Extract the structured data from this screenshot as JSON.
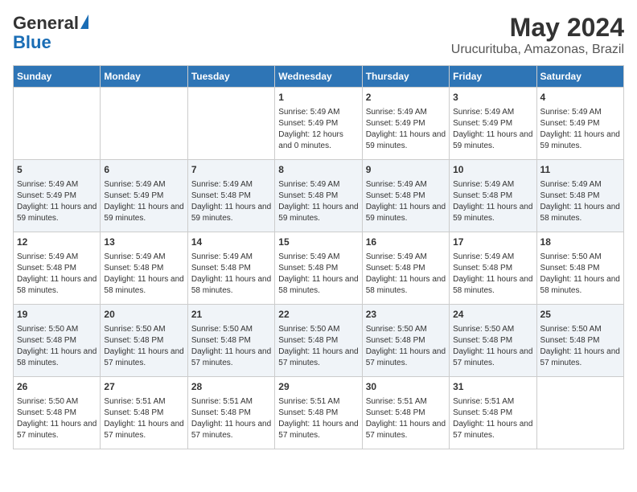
{
  "logo": {
    "general": "General",
    "blue": "Blue"
  },
  "title": "May 2024",
  "subtitle": "Urucurituba, Amazonas, Brazil",
  "days_of_week": [
    "Sunday",
    "Monday",
    "Tuesday",
    "Wednesday",
    "Thursday",
    "Friday",
    "Saturday"
  ],
  "weeks": [
    [
      {
        "day": "",
        "info": ""
      },
      {
        "day": "",
        "info": ""
      },
      {
        "day": "",
        "info": ""
      },
      {
        "day": "1",
        "info": "Sunrise: 5:49 AM\nSunset: 5:49 PM\nDaylight: 12 hours and 0 minutes."
      },
      {
        "day": "2",
        "info": "Sunrise: 5:49 AM\nSunset: 5:49 PM\nDaylight: 11 hours and 59 minutes."
      },
      {
        "day": "3",
        "info": "Sunrise: 5:49 AM\nSunset: 5:49 PM\nDaylight: 11 hours and 59 minutes."
      },
      {
        "day": "4",
        "info": "Sunrise: 5:49 AM\nSunset: 5:49 PM\nDaylight: 11 hours and 59 minutes."
      }
    ],
    [
      {
        "day": "5",
        "info": "Sunrise: 5:49 AM\nSunset: 5:49 PM\nDaylight: 11 hours and 59 minutes."
      },
      {
        "day": "6",
        "info": "Sunrise: 5:49 AM\nSunset: 5:49 PM\nDaylight: 11 hours and 59 minutes."
      },
      {
        "day": "7",
        "info": "Sunrise: 5:49 AM\nSunset: 5:48 PM\nDaylight: 11 hours and 59 minutes."
      },
      {
        "day": "8",
        "info": "Sunrise: 5:49 AM\nSunset: 5:48 PM\nDaylight: 11 hours and 59 minutes."
      },
      {
        "day": "9",
        "info": "Sunrise: 5:49 AM\nSunset: 5:48 PM\nDaylight: 11 hours and 59 minutes."
      },
      {
        "day": "10",
        "info": "Sunrise: 5:49 AM\nSunset: 5:48 PM\nDaylight: 11 hours and 59 minutes."
      },
      {
        "day": "11",
        "info": "Sunrise: 5:49 AM\nSunset: 5:48 PM\nDaylight: 11 hours and 58 minutes."
      }
    ],
    [
      {
        "day": "12",
        "info": "Sunrise: 5:49 AM\nSunset: 5:48 PM\nDaylight: 11 hours and 58 minutes."
      },
      {
        "day": "13",
        "info": "Sunrise: 5:49 AM\nSunset: 5:48 PM\nDaylight: 11 hours and 58 minutes."
      },
      {
        "day": "14",
        "info": "Sunrise: 5:49 AM\nSunset: 5:48 PM\nDaylight: 11 hours and 58 minutes."
      },
      {
        "day": "15",
        "info": "Sunrise: 5:49 AM\nSunset: 5:48 PM\nDaylight: 11 hours and 58 minutes."
      },
      {
        "day": "16",
        "info": "Sunrise: 5:49 AM\nSunset: 5:48 PM\nDaylight: 11 hours and 58 minutes."
      },
      {
        "day": "17",
        "info": "Sunrise: 5:49 AM\nSunset: 5:48 PM\nDaylight: 11 hours and 58 minutes."
      },
      {
        "day": "18",
        "info": "Sunrise: 5:50 AM\nSunset: 5:48 PM\nDaylight: 11 hours and 58 minutes."
      }
    ],
    [
      {
        "day": "19",
        "info": "Sunrise: 5:50 AM\nSunset: 5:48 PM\nDaylight: 11 hours and 58 minutes."
      },
      {
        "day": "20",
        "info": "Sunrise: 5:50 AM\nSunset: 5:48 PM\nDaylight: 11 hours and 57 minutes."
      },
      {
        "day": "21",
        "info": "Sunrise: 5:50 AM\nSunset: 5:48 PM\nDaylight: 11 hours and 57 minutes."
      },
      {
        "day": "22",
        "info": "Sunrise: 5:50 AM\nSunset: 5:48 PM\nDaylight: 11 hours and 57 minutes."
      },
      {
        "day": "23",
        "info": "Sunrise: 5:50 AM\nSunset: 5:48 PM\nDaylight: 11 hours and 57 minutes."
      },
      {
        "day": "24",
        "info": "Sunrise: 5:50 AM\nSunset: 5:48 PM\nDaylight: 11 hours and 57 minutes."
      },
      {
        "day": "25",
        "info": "Sunrise: 5:50 AM\nSunset: 5:48 PM\nDaylight: 11 hours and 57 minutes."
      }
    ],
    [
      {
        "day": "26",
        "info": "Sunrise: 5:50 AM\nSunset: 5:48 PM\nDaylight: 11 hours and 57 minutes."
      },
      {
        "day": "27",
        "info": "Sunrise: 5:51 AM\nSunset: 5:48 PM\nDaylight: 11 hours and 57 minutes."
      },
      {
        "day": "28",
        "info": "Sunrise: 5:51 AM\nSunset: 5:48 PM\nDaylight: 11 hours and 57 minutes."
      },
      {
        "day": "29",
        "info": "Sunrise: 5:51 AM\nSunset: 5:48 PM\nDaylight: 11 hours and 57 minutes."
      },
      {
        "day": "30",
        "info": "Sunrise: 5:51 AM\nSunset: 5:48 PM\nDaylight: 11 hours and 57 minutes."
      },
      {
        "day": "31",
        "info": "Sunrise: 5:51 AM\nSunset: 5:48 PM\nDaylight: 11 hours and 57 minutes."
      },
      {
        "day": "",
        "info": ""
      }
    ]
  ]
}
